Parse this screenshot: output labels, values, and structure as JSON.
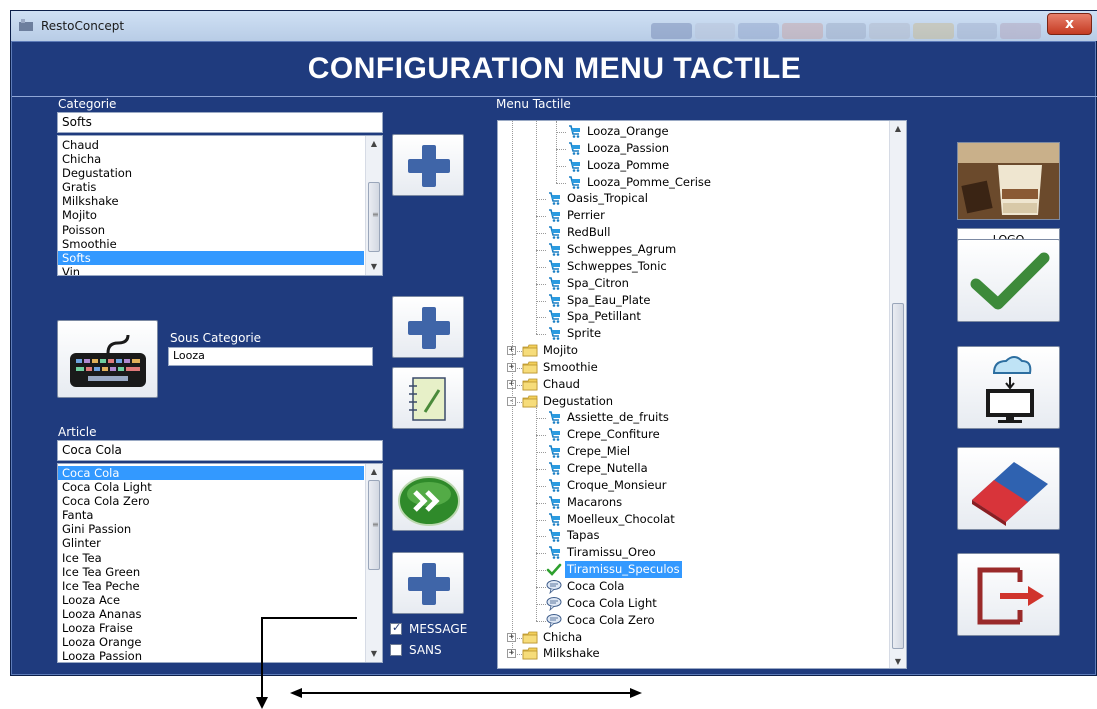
{
  "window": {
    "title": "RestoConcept",
    "close_glyph": "x"
  },
  "heading": "CONFIGURATION MENU TACTILE",
  "categorie": {
    "label": "Categorie",
    "value": "Softs",
    "items": [
      "Chaud",
      "Chicha",
      "Degustation",
      "Gratis",
      "Milkshake",
      "Mojito",
      "Poisson",
      "Smoothie",
      "Softs",
      "Vin"
    ],
    "selected": "Softs"
  },
  "sous_categorie": {
    "label": "Sous Categorie",
    "value": "Looza"
  },
  "article": {
    "label": "Article",
    "value": "Coca Cola",
    "items": [
      "Coca Cola",
      "Coca Cola Light",
      "Coca Cola Zero",
      "Fanta",
      "Gini Passion",
      "Glinter",
      "Ice Tea",
      "Ice Tea Green",
      "Ice Tea Peche",
      "Looza Ace",
      "Looza Ananas",
      "Looza Fraise",
      "Looza Orange",
      "Looza Passion"
    ],
    "selected": "Coca Cola"
  },
  "menu_tactile": {
    "label": "Menu Tactile",
    "nodes": [
      {
        "text": "Looza_Orange",
        "icon": "cart-icon",
        "level": 3
      },
      {
        "text": "Looza_Passion",
        "icon": "cart-icon",
        "level": 3
      },
      {
        "text": "Looza_Pomme",
        "icon": "cart-icon",
        "level": 3
      },
      {
        "text": "Looza_Pomme_Cerise",
        "icon": "cart-icon",
        "level": 3
      },
      {
        "text": "Oasis_Tropical",
        "icon": "cart-icon",
        "level": 2
      },
      {
        "text": "Perrier",
        "icon": "cart-icon",
        "level": 2
      },
      {
        "text": "RedBull",
        "icon": "cart-icon",
        "level": 2
      },
      {
        "text": "Schweppes_Agrum",
        "icon": "cart-icon",
        "level": 2
      },
      {
        "text": "Schweppes_Tonic",
        "icon": "cart-icon",
        "level": 2
      },
      {
        "text": "Spa_Citron",
        "icon": "cart-icon",
        "level": 2
      },
      {
        "text": "Spa_Eau_Plate",
        "icon": "cart-icon",
        "level": 2
      },
      {
        "text": "Spa_Petillant",
        "icon": "cart-icon",
        "level": 2
      },
      {
        "text": "Sprite",
        "icon": "cart-icon",
        "level": 2
      },
      {
        "text": "Mojito",
        "icon": "folder-icon",
        "level": 1,
        "expander": "+"
      },
      {
        "text": "Smoothie",
        "icon": "folder-icon",
        "level": 1,
        "expander": "+"
      },
      {
        "text": "Chaud",
        "icon": "folder-icon",
        "level": 1,
        "expander": "+"
      },
      {
        "text": "Degustation",
        "icon": "folder-icon",
        "level": 1,
        "expander": "-"
      },
      {
        "text": "Assiette_de_fruits",
        "icon": "cart-icon",
        "level": 2
      },
      {
        "text": "Crepe_Confiture",
        "icon": "cart-icon",
        "level": 2
      },
      {
        "text": "Crepe_Miel",
        "icon": "cart-icon",
        "level": 2
      },
      {
        "text": "Crepe_Nutella",
        "icon": "cart-icon",
        "level": 2
      },
      {
        "text": "Croque_Monsieur",
        "icon": "cart-icon",
        "level": 2
      },
      {
        "text": "Macarons",
        "icon": "cart-icon",
        "level": 2
      },
      {
        "text": "Moelleux_Chocolat",
        "icon": "cart-icon",
        "level": 2
      },
      {
        "text": "Tapas",
        "icon": "cart-icon",
        "level": 2
      },
      {
        "text": "Tiramissu_Oreo",
        "icon": "cart-icon",
        "level": 2
      },
      {
        "text": "Tiramissu_Speculos",
        "icon": "checkmark-icon",
        "level": 2,
        "selected": true
      },
      {
        "text": "Coca Cola",
        "icon": "message-icon",
        "level": 2
      },
      {
        "text": "Coca Cola Light",
        "icon": "message-icon",
        "level": 2
      },
      {
        "text": "Coca Cola Zero",
        "icon": "message-icon",
        "level": 2
      },
      {
        "text": "Chicha",
        "icon": "folder-icon",
        "level": 1,
        "expander": "+"
      },
      {
        "text": "Milkshake",
        "icon": "folder-icon",
        "level": 1,
        "expander": "+"
      }
    ]
  },
  "options": {
    "message": {
      "label": "MESSAGE",
      "checked": true
    },
    "sans": {
      "label": "SANS",
      "checked": false
    }
  },
  "logo_button": "LOGO",
  "icons": {
    "add": "plus-icon",
    "keyboard": "keyboard-icon",
    "edit": "notepad-icon",
    "transfer": "double-chevron-icon",
    "validate": "checkmark-icon",
    "cloud_sync": "cloud-download-icon",
    "erase": "eraser-icon",
    "exit": "exit-icon"
  },
  "colors": {
    "window_bg": "#1f3b7e",
    "selection": "#3399ff",
    "plus": "#3f65a8",
    "check_green": "#3d8a3a",
    "eraser_red": "#d8343a",
    "exit_red": "#9a2a2a"
  }
}
